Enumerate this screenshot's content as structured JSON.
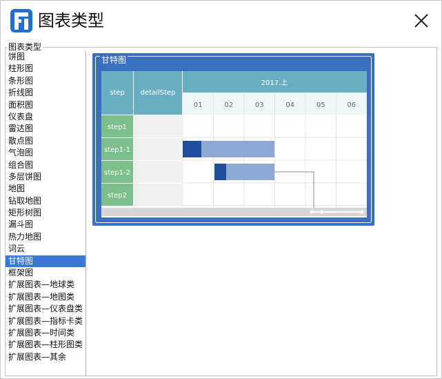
{
  "window": {
    "title": "图表类型"
  },
  "group": {
    "legend": "图表类型"
  },
  "chart_types": [
    {
      "label": "饼图",
      "selected": false
    },
    {
      "label": "柱形图",
      "selected": false
    },
    {
      "label": "条形图",
      "selected": false
    },
    {
      "label": "折线图",
      "selected": false
    },
    {
      "label": "面积图",
      "selected": false
    },
    {
      "label": "仪表盘",
      "selected": false
    },
    {
      "label": "雷达图",
      "selected": false
    },
    {
      "label": "散点图",
      "selected": false
    },
    {
      "label": "气泡图",
      "selected": false
    },
    {
      "label": "组合图",
      "selected": false
    },
    {
      "label": "多层饼图",
      "selected": false
    },
    {
      "label": "地图",
      "selected": false
    },
    {
      "label": "钻取地图",
      "selected": false
    },
    {
      "label": "矩形树图",
      "selected": false
    },
    {
      "label": "漏斗图",
      "selected": false
    },
    {
      "label": "热力地图",
      "selected": false
    },
    {
      "label": "词云",
      "selected": false
    },
    {
      "label": "甘特图",
      "selected": true
    },
    {
      "label": "框架图",
      "selected": false
    },
    {
      "label": "扩展图表—地球类",
      "selected": false
    },
    {
      "label": "扩展图表—地图类",
      "selected": false
    },
    {
      "label": "扩展图表—仪表盘类",
      "selected": false
    },
    {
      "label": "扩展图表—指标卡类",
      "selected": false
    },
    {
      "label": "扩展图表—时间类",
      "selected": false
    },
    {
      "label": "扩展图表—柱形图类",
      "selected": false
    },
    {
      "label": "扩展图表—其余",
      "selected": false
    }
  ],
  "preview": {
    "label": "甘特图",
    "gantt": {
      "col_step": "step",
      "col_detail": "detailStep",
      "period": "2017.上",
      "months": [
        "01",
        "02",
        "03",
        "04",
        "05",
        "06"
      ],
      "rows": [
        "step1",
        "step1-1",
        "step1-2",
        "step2"
      ]
    }
  },
  "colors": {
    "accent": "#3b78d8",
    "frame": "#3b6fc0",
    "header_teal": "#6aaec4",
    "header_light": "#edf6f9",
    "row_green": "#7cbf8a",
    "bar_dark": "#1f4e9e",
    "bar_light": "#8fa8d4"
  }
}
